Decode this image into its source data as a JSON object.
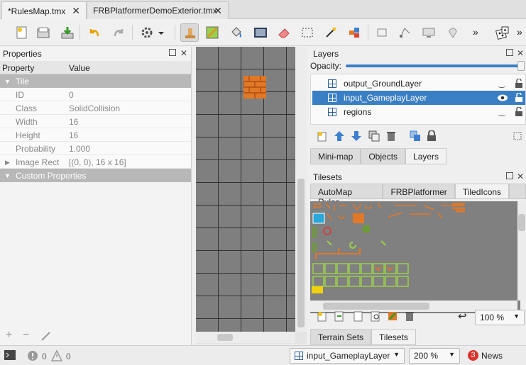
{
  "tabs": [
    {
      "label": "*RulesMap.tmx",
      "close": "✕"
    },
    {
      "label": "FRBPlatformerDemoExterior.tmx",
      "close": "✕"
    }
  ],
  "toolbar": {
    "overflow_left": "»",
    "overflow_right": "»"
  },
  "properties": {
    "title": "Properties",
    "col_property": "Property",
    "col_value": "Value",
    "group_tile": "Tile",
    "rows": [
      {
        "key": "ID",
        "value": "0"
      },
      {
        "key": "Class",
        "value": "SolidCollision"
      },
      {
        "key": "Width",
        "value": "16"
      },
      {
        "key": "Height",
        "value": "16"
      },
      {
        "key": "Probability",
        "value": "1.000"
      },
      {
        "key": "Image Rect",
        "value": "[(0, 0), 16 x 16]"
      }
    ],
    "group_custom": "Custom Properties"
  },
  "layers": {
    "title": "Layers",
    "opacity_label": "Opacity:",
    "opacity_value": 1.0,
    "items": [
      {
        "name": "output_GroundLayer",
        "selected": false
      },
      {
        "name": "input_GameplayLayer",
        "selected": true
      },
      {
        "name": "regions",
        "selected": false
      }
    ],
    "tabs": [
      "Mini-map",
      "Objects",
      "Layers"
    ],
    "active_tab": "Layers"
  },
  "tilesets": {
    "title": "Tilesets",
    "tabs": [
      "AutoMap Rules",
      "FRBPlatformer",
      "TiledIcons"
    ],
    "active_tab": "TiledIcons",
    "zoom": "100 %",
    "bottom_tabs": [
      "Terrain Sets",
      "Tilesets"
    ],
    "active_bottom_tab": "Tilesets"
  },
  "status": {
    "errors": "0",
    "warnings": "0",
    "current_layer": "input_GameplayLayer",
    "zoom": "200 %",
    "news_count": "3",
    "news_label": "News"
  },
  "colors": {
    "accent": "#3a7fc4",
    "group_header": "#b8b8b8",
    "canvas_bg": "#7f7f7f",
    "tile_orange": "#e07828",
    "news_badge": "#d9342b"
  }
}
